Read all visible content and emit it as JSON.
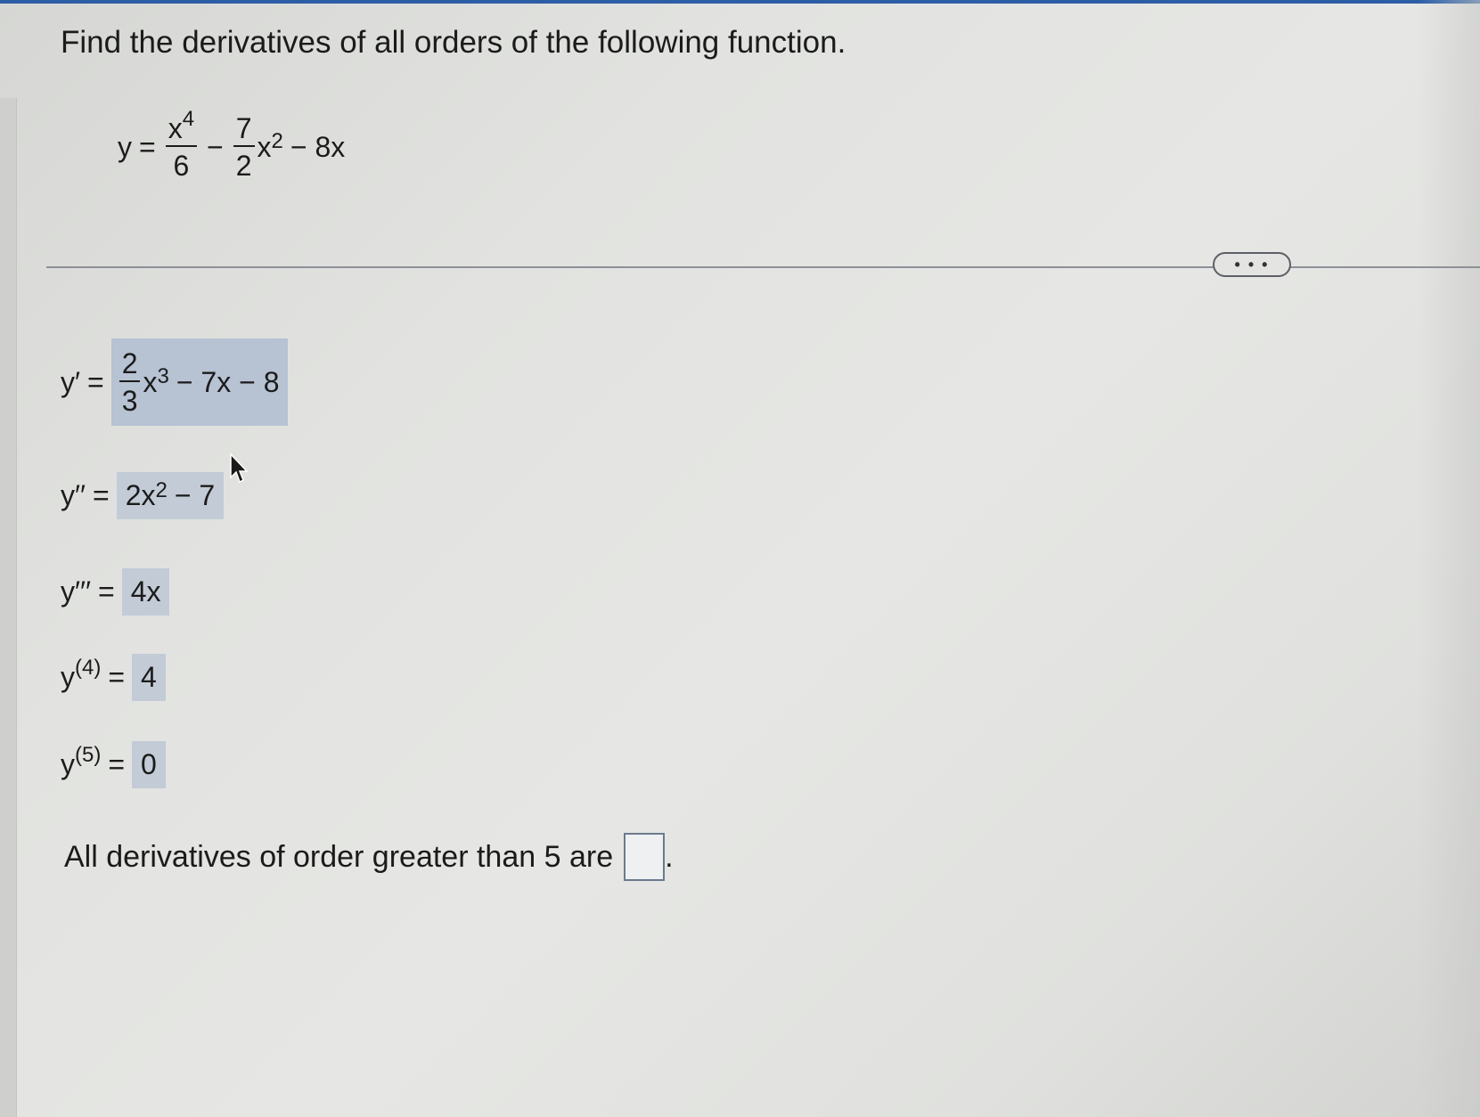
{
  "question": "Find the derivatives of all orders of the following function.",
  "function": {
    "lhs": "y",
    "eq": "=",
    "t1_num_base": "x",
    "t1_num_exp": "4",
    "t1_den": "6",
    "op1": "−",
    "t2_num": "7",
    "t2_den": "2",
    "t2_var": "x",
    "t2_exp": "2",
    "rest": "− 8x"
  },
  "derivatives": {
    "d1": {
      "label": "y′",
      "eq": "=",
      "frac_num": "2",
      "frac_den": "3",
      "var": "x",
      "exp": "3",
      "rest": "− 7x − 8"
    },
    "d2": {
      "label": "y′′",
      "eq": "=",
      "pre": "2x",
      "exp": "2",
      "rest": "− 7"
    },
    "d3": {
      "label": "y′′′",
      "eq": "=",
      "value": "4x"
    },
    "d4": {
      "label": "y",
      "order": "(4)",
      "eq": "=",
      "value": "4"
    },
    "d5": {
      "label": "y",
      "order": "(5)",
      "eq": "=",
      "value": "0"
    }
  },
  "more_button": "• • •",
  "final": {
    "text": "All derivatives of order greater than 5 are",
    "answer": "",
    "period": "."
  }
}
